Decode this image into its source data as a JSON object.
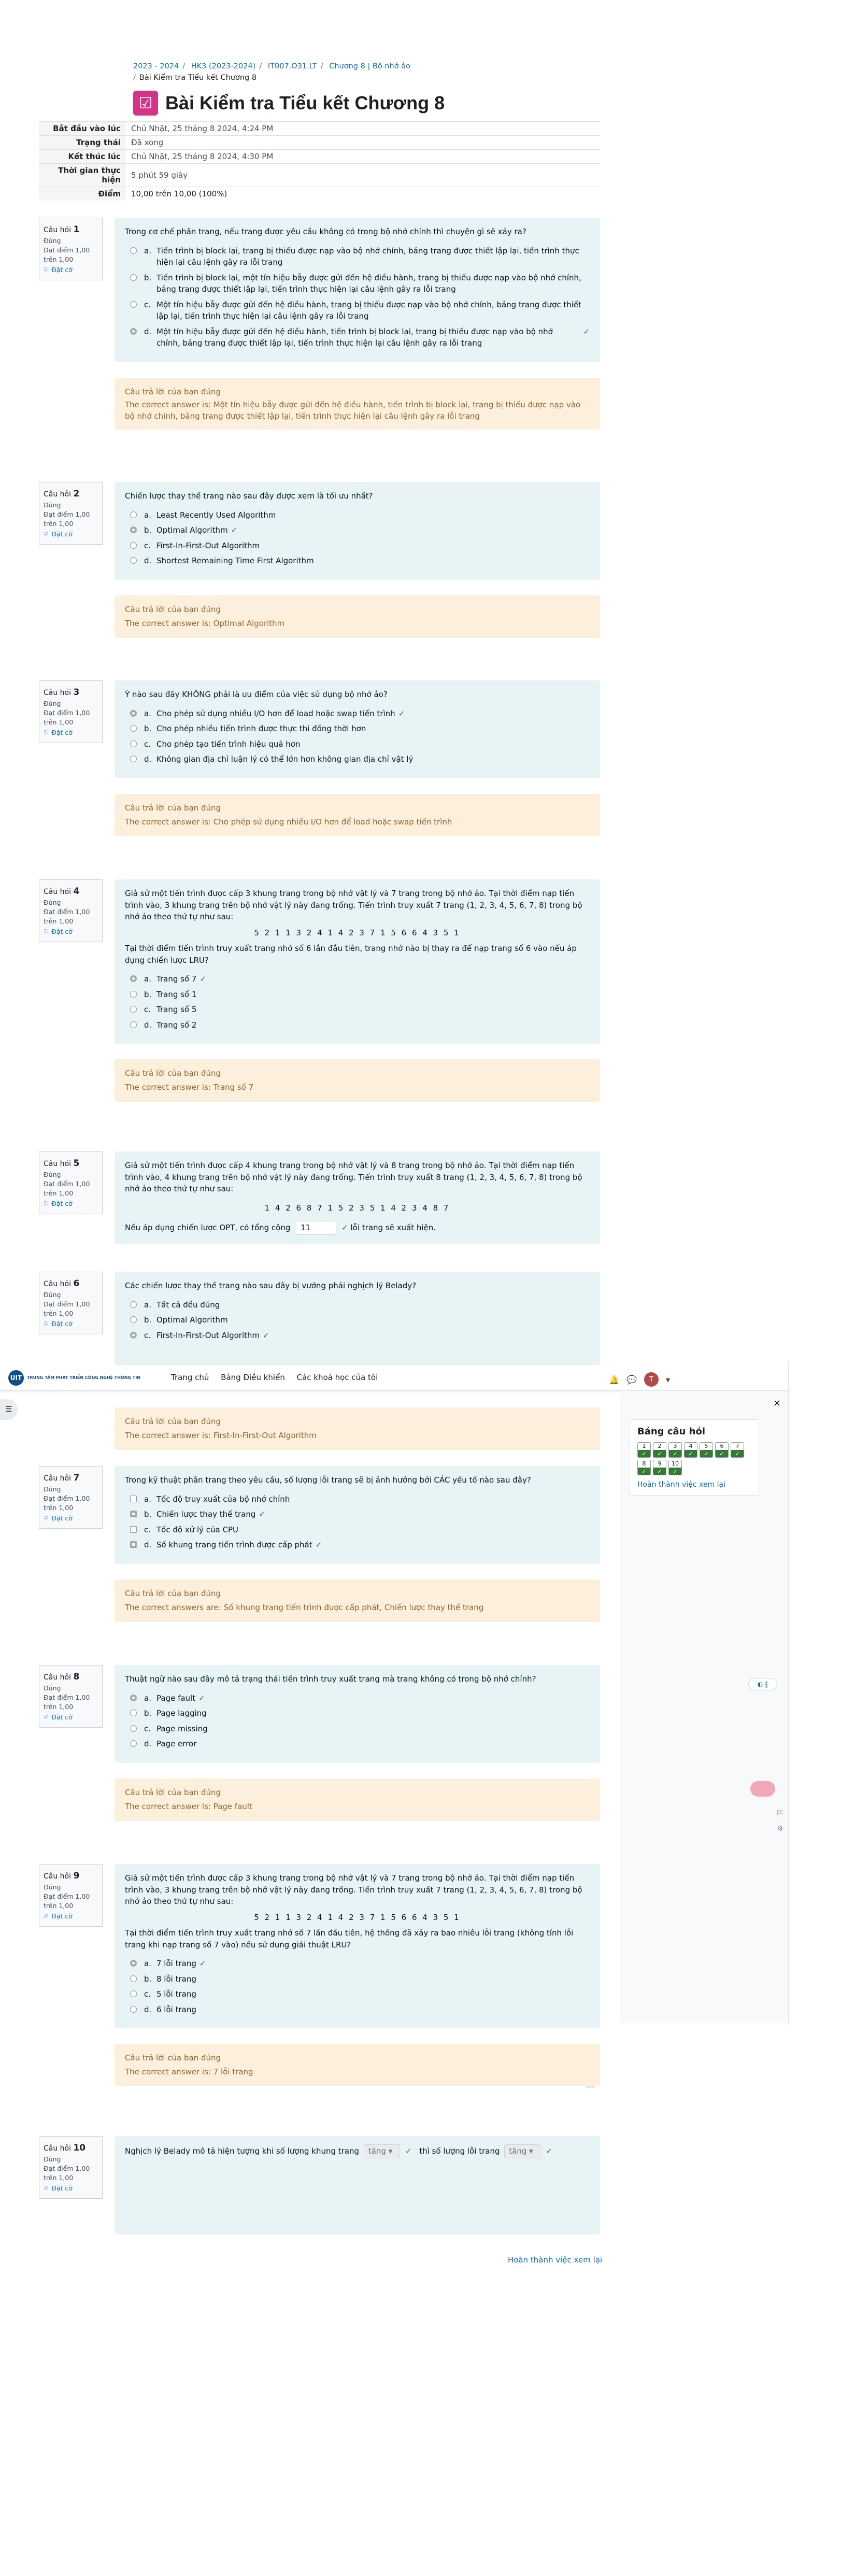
{
  "breadcrumb": {
    "items": [
      "2023 - 2024",
      "HK3 (2023-2024)",
      "IT007.O31.LT",
      "Chương 8 | Bộ nhớ ảo"
    ],
    "current": "Bài Kiểm tra Tiểu kết Chương 8"
  },
  "page": {
    "title": "Bài Kiểm tra Tiểu kết Chương 8"
  },
  "summary": [
    {
      "label": "Bắt đầu vào lúc",
      "value": "Chủ Nhật, 25 tháng 8 2024, 4:24 PM"
    },
    {
      "label": "Trạng thái",
      "value": "Đã xong"
    },
    {
      "label": "Kết thúc lúc",
      "value": "Chủ Nhật, 25 tháng 8 2024, 4:30 PM"
    },
    {
      "label": "Thời gian thực hiện",
      "value": "5 phút 59 giây"
    },
    {
      "label": "Điểm",
      "value": "10,00 trên 10,00 (100%)"
    }
  ],
  "qinfo": {
    "prefix": "Câu hỏi",
    "status": "Đúng",
    "mark": "Đạt điểm 1,00 trên 1,00",
    "flag": "Đặt cờ"
  },
  "feedback_label": "Câu trả lời của bạn đúng",
  "questions": [
    {
      "no": "1",
      "text": "Trong cơ chế phân trang, nếu trang được yêu cầu không có trong bộ nhớ chính thì chuyện gì sẽ xảy ra?",
      "options": [
        {
          "letter": "a.",
          "text": "Tiến trình bị block lại, trang bị thiếu được nạp vào bộ nhớ chính, bảng trang được thiết lập lại, tiến trình thực hiện lại câu lệnh gây ra lỗi trang"
        },
        {
          "letter": "b.",
          "text": "Tiến trình bị block lại, một tín hiệu bẫy được gửi đến hệ điều hành, trang bị thiếu được nạp vào bộ nhớ chính, bảng trang được thiết lập lại, tiến trình thực hiện lại câu lệnh gây ra lỗi trang"
        },
        {
          "letter": "c.",
          "text": "Một tín hiệu bẫy được gửi đến hệ điều hành, trang bị thiếu được nạp vào bộ nhớ chính, bảng trang được thiết lập lại, tiến trình thực hiện lại câu lệnh gây ra lỗi trang"
        },
        {
          "letter": "d.",
          "text": "Một tín hiệu bẫy được gửi đến hệ điều hành, tiến trình bị block lại, trang bị thiếu được nạp vào bộ nhớ chính, bảng trang được thiết lập lại, tiến trình thực hiện lại câu lệnh gây ra lỗi trang"
        }
      ],
      "answer": "The correct answer is: Một tín hiệu bẫy được gửi đến hệ điều hành, tiến trình bị block lại, trang bị thiếu được nạp vào bộ nhớ chính, bảng trang được thiết lập lại, tiến trình thực hiện lại câu lệnh gây ra lỗi trang"
    },
    {
      "no": "2",
      "text": "Chiến lược thay thế trang nào sau đây được xem là tối ưu nhất?",
      "options": [
        {
          "letter": "a.",
          "text": "Least Recently Used Algorithm"
        },
        {
          "letter": "b.",
          "text": "Optimal Algorithm"
        },
        {
          "letter": "c.",
          "text": "First-In-First-Out Algorithm"
        },
        {
          "letter": "d.",
          "text": "Shortest Remaining Time First Algorithm"
        }
      ],
      "answer": "The correct answer is: Optimal Algorithm"
    },
    {
      "no": "3",
      "text": "Ý nào sau đây KHÔNG phải là ưu điểm của việc sử dụng bộ nhớ ảo?",
      "options": [
        {
          "letter": "a.",
          "text": "Cho phép sử dụng nhiều I/O hơn để load hoặc swap tiến trình"
        },
        {
          "letter": "b.",
          "text": "Cho phép nhiều tiến trình được thực thi đồng thời hơn"
        },
        {
          "letter": "c.",
          "text": "Cho phép tạo tiến trình hiệu quả hơn"
        },
        {
          "letter": "d.",
          "text": "Không gian địa chỉ luận lý có thể lớn hơn không gian địa chỉ vật lý"
        }
      ],
      "answer": "The correct answer is: Cho phép sử dụng nhiều I/O hơn để load hoặc swap tiến trình"
    },
    {
      "no": "4",
      "text": "Giả sử một tiến trình được cấp 3 khung trang trong bộ nhớ vật lý và 7 trang trong bộ nhớ ảo. Tại thời điểm nạp tiến trình vào, 3 khung trang trên bộ nhớ vật lý này đang trống. Tiến trình truy xuất 7 trang (1, 2, 3, 4, 5, 6, 7, 8) trong bộ nhớ ảo theo thứ tự như sau:",
      "ref": "5 2 1 1 3 2 4 1 4 2 3 7 1 5 6 6 4 3 5 1",
      "text2": "Tại thời điểm tiến trình truy xuất trang nhớ số 6 lần đầu tiên, trang nhớ nào bị thay ra để nạp trang số 6 vào nếu áp dụng chiến lược LRU?",
      "options": [
        {
          "letter": "a.",
          "text": "Trang số 7"
        },
        {
          "letter": "b.",
          "text": "Trang số 1"
        },
        {
          "letter": "c.",
          "text": "Trang số 5"
        },
        {
          "letter": "d.",
          "text": "Trang số 2"
        }
      ],
      "answer": "The correct answer is: Trang số 7"
    },
    {
      "no": "5",
      "text": "Giả sử một tiến trình được cấp 4 khung trang trong bộ nhớ vật lý và 8 trang trong bộ nhớ ảo. Tại thời điểm nạp tiến trình vào, 4 khung trang trên bộ nhớ vật lý này đang trống. Tiến trình truy xuất 8 trang (1, 2, 3, 4, 5, 6, 7, 8) trong bộ nhớ ảo theo thứ tự như sau:",
      "ref": "1 4 2 6 8 7 1 5 2 3 5 1 4 2 3 4 8 7",
      "pre": "Nếu áp dụng chiến lược OPT, có tổng cộng",
      "value": "11",
      "post": "lỗi trang sẽ xuất hiện."
    },
    {
      "no": "6",
      "text": "Các chiến lược thay thế trang nào sau đây bị vướng phải nghịch lý Belady?",
      "options": [
        {
          "letter": "a.",
          "text": "Tất cả đều đúng"
        },
        {
          "letter": "b.",
          "text": "Optimal Algorithm"
        },
        {
          "letter": "c.",
          "text": "First-In-First-Out Algorithm"
        }
      ],
      "answer": "The correct answer is: First-In-First-Out Algorithm"
    },
    {
      "no": "7",
      "text": "Trong kỹ thuật phân trang theo yêu cầu, số lượng lỗi trang sẽ bị ảnh hưởng bởi CÁC yếu tố nào sau đây?",
      "options": [
        {
          "letter": "a.",
          "text": "Tốc độ truy xuất của bộ nhớ chính"
        },
        {
          "letter": "b.",
          "text": "Chiến lược thay thế trang"
        },
        {
          "letter": "c.",
          "text": "Tốc độ xử lý của CPU"
        },
        {
          "letter": "d.",
          "text": "Số khung trang tiến trình được cấp phát"
        }
      ],
      "answer": "The correct answers are: Số khung trang tiến trình được cấp phát, Chiến lược thay thế trang"
    },
    {
      "no": "8",
      "text": "Thuật ngữ nào sau đây mô tả trạng thái tiến trình truy xuất trang mà trang không có trong bộ nhớ chính?",
      "options": [
        {
          "letter": "a.",
          "text": "Page fault"
        },
        {
          "letter": "b.",
          "text": "Page lagging"
        },
        {
          "letter": "c.",
          "text": "Page missing"
        },
        {
          "letter": "d.",
          "text": "Page error"
        }
      ],
      "answer": "The correct answer is: Page fault"
    },
    {
      "no": "9",
      "text": "Giả sử một tiến trình được cấp 3 khung trang trong bộ nhớ vật lý và 7 trang trong bộ nhớ ảo. Tại thời điểm nạp tiến trình vào, 3 khung trang trên bộ nhớ vật lý này đang trống. Tiến trình truy xuất 7 trang (1, 2, 3, 4, 5, 6, 7, 8) trong bộ nhớ ảo theo thứ tự như sau:",
      "ref": "5 2 1 1 3 2 4 1 4 2 3 7 1 5 6 6 4 3 5 1",
      "text2": "Tại thời điểm tiến trình truy xuất trang nhớ số 7 lần đầu tiên, hệ thống đã xảy ra bao nhiêu lỗi trang (không tính lỗi trang khi nạp trang số 7 vào) nếu sử dụng giải thuật LRU?",
      "options": [
        {
          "letter": "a.",
          "text": "7 lỗi trang"
        },
        {
          "letter": "b.",
          "text": "8 lỗi trang"
        },
        {
          "letter": "c.",
          "text": "5 lỗi trang"
        },
        {
          "letter": "d.",
          "text": "6 lỗi trang"
        }
      ],
      "answer": "The correct answer is: 7 lỗi trang"
    },
    {
      "no": "10",
      "pre": "Nghịch lý Belady mô tả hiện tượng khi số lượng khung trang",
      "sel1": "tăng",
      "mid": "thì số lượng lỗi trang",
      "sel2": "tăng"
    }
  ],
  "navbar": {
    "logo_abbr": "UIT",
    "logo_text": "TRUNG TÂM PHÁT TRIỂN CÔNG NGHỆ THÔNG TIN",
    "links": [
      "Trang chủ",
      "Bảng Điều khiển",
      "Các khoá học của tôi"
    ],
    "avatar": "T"
  },
  "drawer": {
    "title": "Bảng câu hỏi",
    "buttons": [
      "1",
      "2",
      "3",
      "4",
      "5",
      "6",
      "7",
      "8",
      "9",
      "10"
    ],
    "finish": "Hoàn thành việc xem lại"
  },
  "footer": {
    "finish": "Hoàn thành việc xem lại"
  },
  "icons": {
    "check": "✓",
    "flag": "⚐",
    "close": "✕",
    "bell": "🔔",
    "chat": "💬",
    "menu": "☰"
  },
  "colors": {
    "correct": "#357a32",
    "link": "#0f6cbf",
    "formulation_bg": "#e7f3f5",
    "feedback_bg": "#fcefdc",
    "title_icon": "#d63384"
  }
}
